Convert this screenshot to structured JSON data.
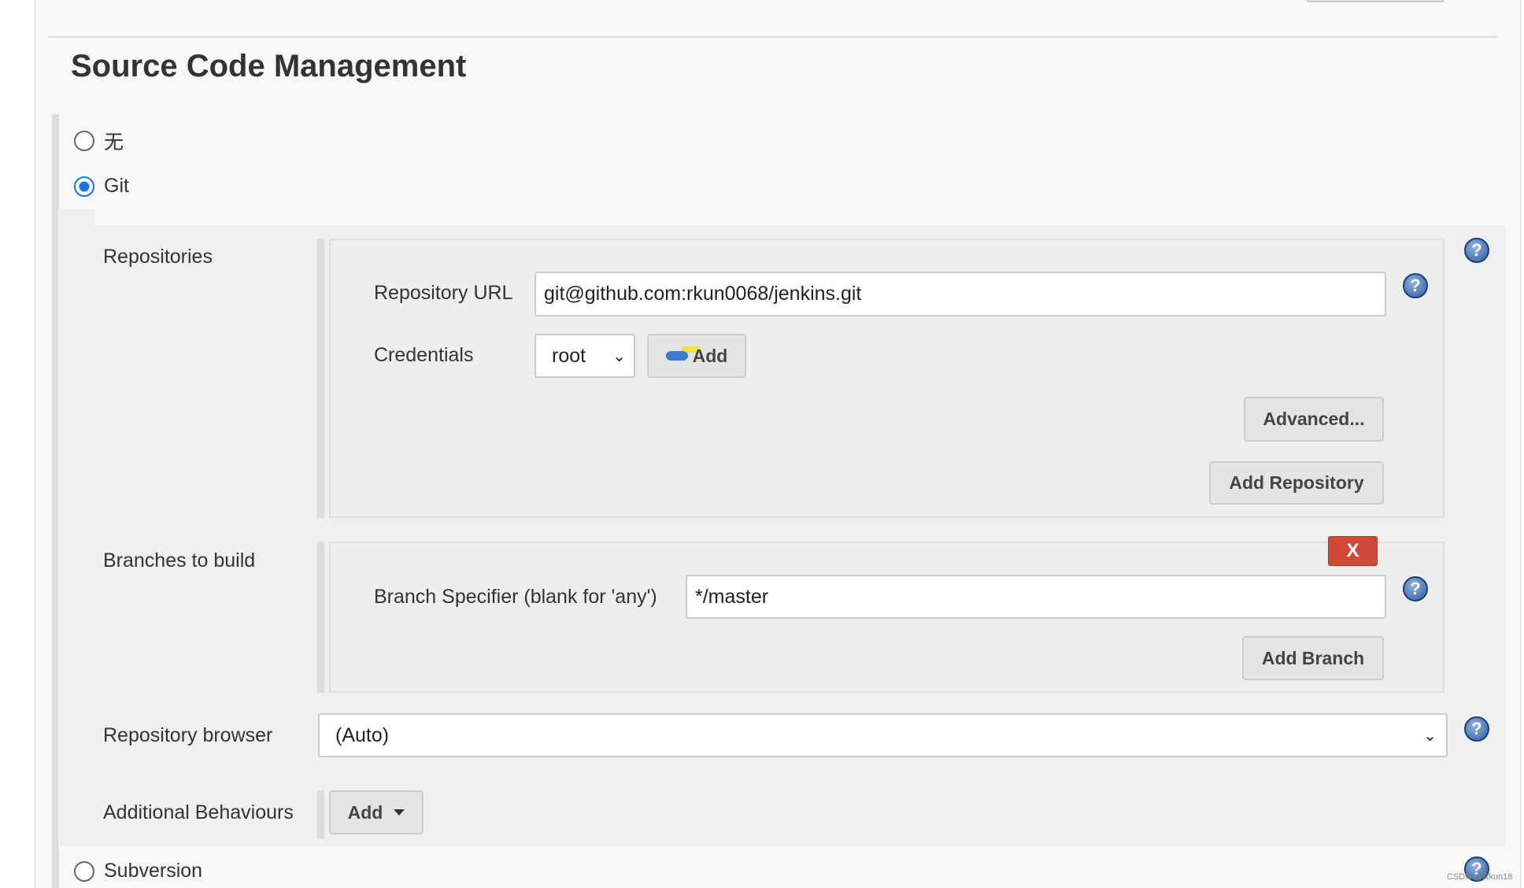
{
  "section_title": "Source Code Management",
  "scm_options": [
    {
      "label": "无",
      "selected": false
    },
    {
      "label": "Git",
      "selected": true
    },
    {
      "label": "Subversion",
      "selected": false
    }
  ],
  "git": {
    "repositories_label": "Repositories",
    "repository_url_label": "Repository URL",
    "repository_url_value": "git@github.com:rkun0068/jenkins.git",
    "credentials_label": "Credentials",
    "credentials_value": "root",
    "credentials_add_label": "Add",
    "advanced_label": "Advanced...",
    "add_repository_label": "Add Repository",
    "branches_label": "Branches to build",
    "delete_branch_label": "X",
    "branch_specifier_label": "Branch Specifier (blank for 'any')",
    "branch_specifier_value": "*/master",
    "add_branch_label": "Add Branch",
    "repository_browser_label": "Repository browser",
    "repository_browser_value": "(Auto)",
    "additional_behaviours_label": "Additional Behaviours",
    "additional_add_label": "Add"
  },
  "help_symbol": "?",
  "watermark": "CSDN @Rkun18",
  "colors": {
    "delete_button": "#d24939",
    "radio_selected": "#1a73e8"
  }
}
